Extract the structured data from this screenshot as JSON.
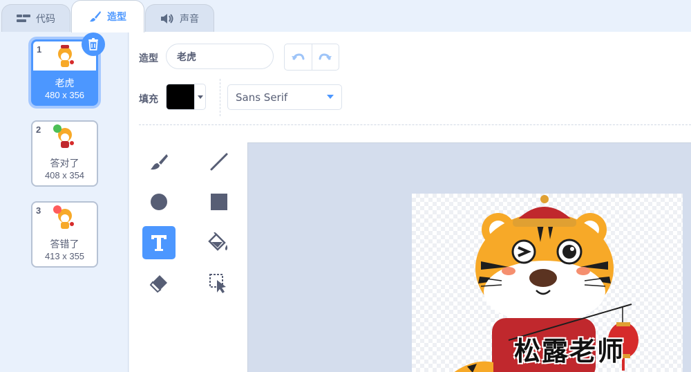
{
  "tabs": [
    {
      "label": "代码",
      "icon": "code-icon",
      "active": false
    },
    {
      "label": "造型",
      "icon": "brush-icon",
      "active": true
    },
    {
      "label": "声音",
      "icon": "speaker-icon",
      "active": false
    }
  ],
  "costumes": [
    {
      "number": "1",
      "name": "老虎",
      "size": "480 x 356",
      "selected": true
    },
    {
      "number": "2",
      "name": "答对了",
      "size": "408 x 354",
      "selected": false,
      "badge": "check-badge-icon"
    },
    {
      "number": "3",
      "name": "答错了",
      "size": "413 x 355",
      "selected": false,
      "badge": "cross-badge-icon"
    }
  ],
  "editor": {
    "costume_label": "造型",
    "costume_name": "老虎",
    "fill_label": "填充",
    "fill_color": "#000000",
    "font": "Sans Serif",
    "tools": [
      "brush-icon",
      "line-icon",
      "circle-icon",
      "rectangle-icon",
      "text-icon",
      "fill-icon",
      "eraser-icon",
      "select-icon"
    ],
    "active_tool": "text-icon"
  },
  "canvas": {
    "watermark": "松露老师"
  },
  "colors": {
    "accent": "#4c97ff",
    "text": "#575e75",
    "badge_ok": "#4cbf56",
    "badge_err": "#ff5c5c"
  }
}
